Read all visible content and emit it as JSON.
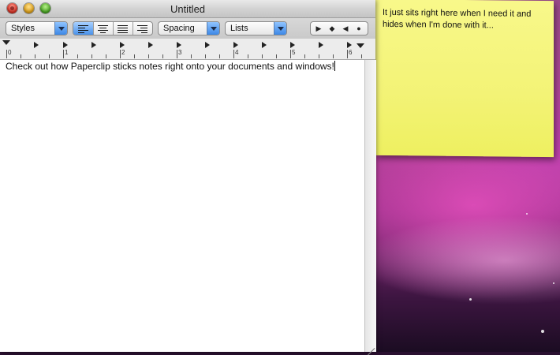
{
  "window": {
    "title": "Untitled"
  },
  "toolbar": {
    "styles_label": "Styles",
    "spacing_label": "Spacing",
    "lists_label": "Lists",
    "alignment": [
      "align-left",
      "align-center",
      "align-justify",
      "align-right"
    ],
    "active_alignment": "align-left",
    "nav_buttons": [
      "play-icon",
      "diamond-icon",
      "back-icon",
      "stop-icon"
    ]
  },
  "ruler": {
    "numbers": [
      "0",
      "1",
      "2",
      "3",
      "4",
      "5",
      "6"
    ]
  },
  "document": {
    "text": "Check out how Paperclip sticks notes right onto your documents and windows!"
  },
  "sticky_note": {
    "text": "It just sits right here when I need it and hides when I'm done with it..."
  }
}
